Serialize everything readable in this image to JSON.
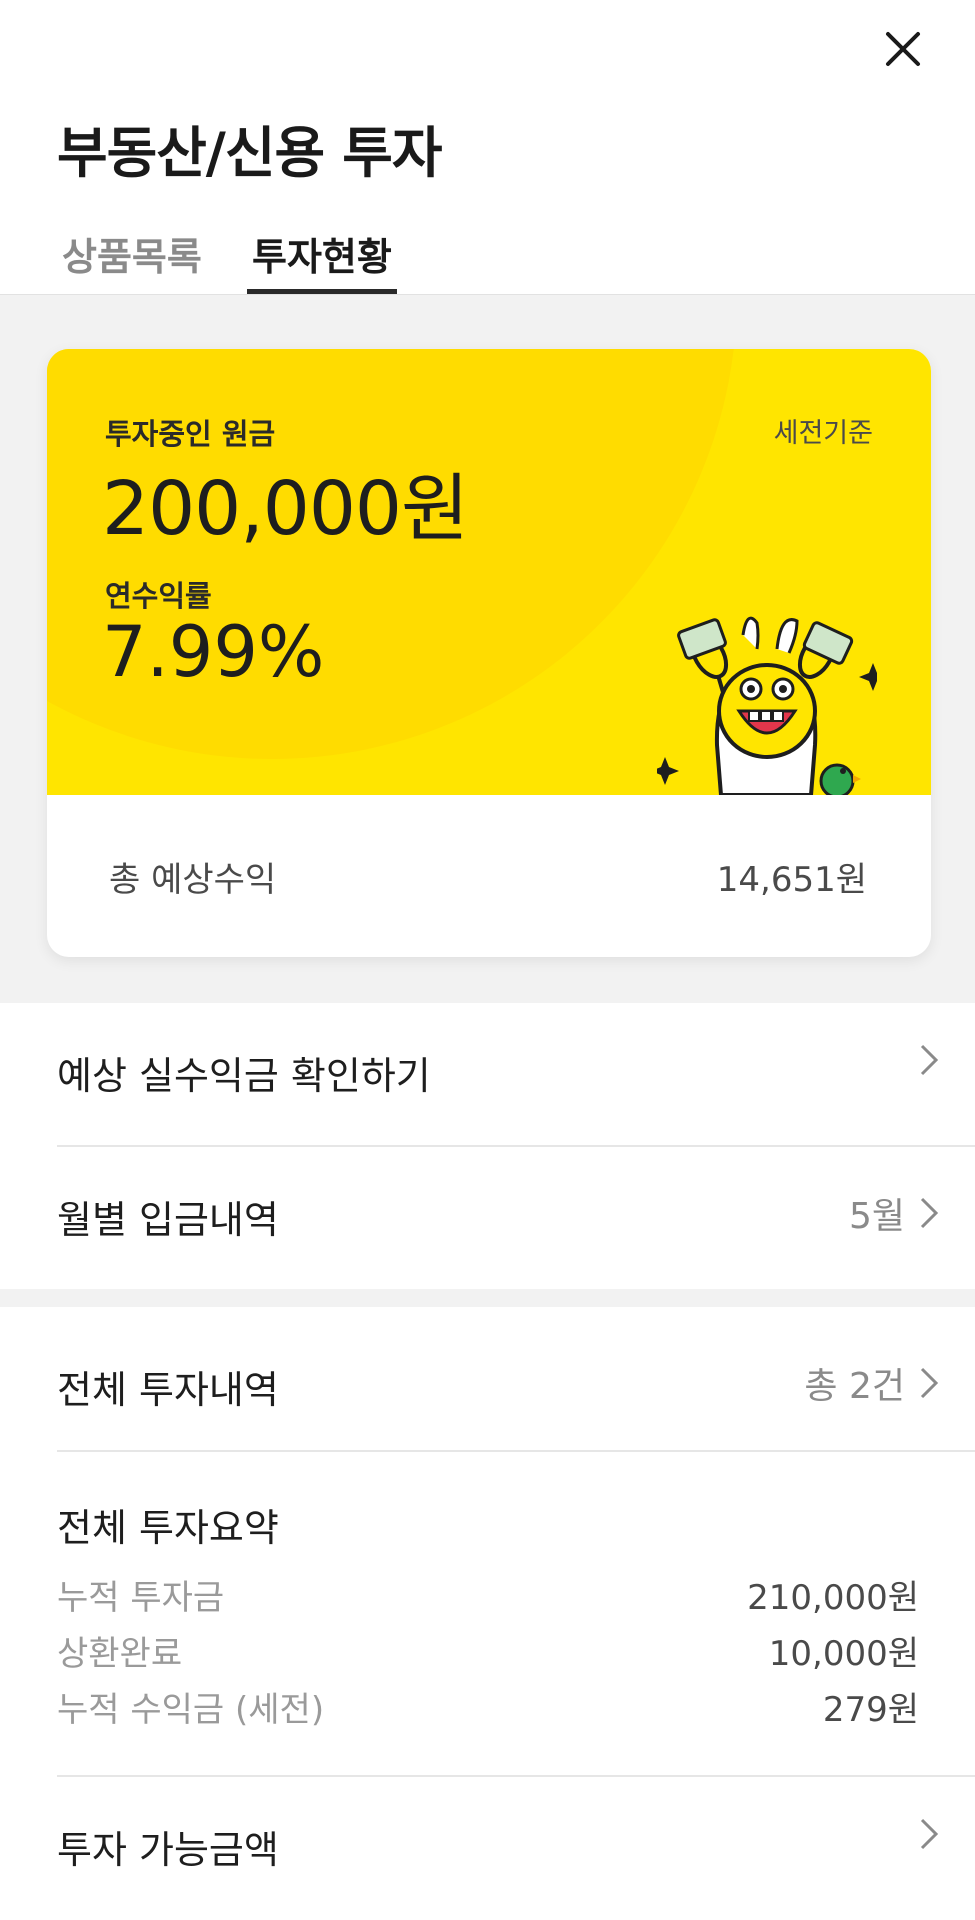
{
  "header": {
    "title": "부동산/신용 투자",
    "close_icon": "close-icon"
  },
  "tabs": [
    {
      "label": "상품목록",
      "active": false
    },
    {
      "label": "투자현황",
      "active": true
    }
  ],
  "card": {
    "principal_label": "투자중인 원금",
    "tax_basis": "세전기준",
    "principal_value": "200,000원",
    "rate_label": "연수익률",
    "rate_value": "7.99%",
    "expected_label": "총 예상수익",
    "expected_value": "14,651원",
    "accent_color": "#ffe500"
  },
  "menu": {
    "net_profit": {
      "label": "예상 실수익금 확인하기",
      "value": ""
    },
    "monthly_deposits": {
      "label": "월별 입금내역",
      "value": "5월"
    },
    "all_investments": {
      "label": "전체 투자내역",
      "value": "총 2건"
    }
  },
  "summary": {
    "title": "전체 투자요약",
    "rows": [
      {
        "label": "누적 투자금",
        "value": "210,000원"
      },
      {
        "label": "상환완료",
        "value": "10,000원"
      },
      {
        "label": "누적 수익금 (세전)",
        "value": "279원"
      }
    ]
  },
  "available": {
    "label": "투자 가능금액"
  }
}
